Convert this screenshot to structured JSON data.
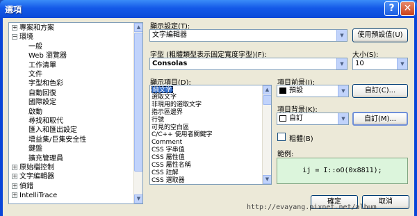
{
  "window": {
    "title": "選項",
    "help_glyph": "?",
    "close_glyph": "✕"
  },
  "tree": {
    "items": [
      {
        "label": "專案和方案",
        "twisty": "+"
      },
      {
        "label": "環境",
        "twisty": "−"
      },
      {
        "label": "一般"
      },
      {
        "label": "Web 瀏覽器"
      },
      {
        "label": "工作清單"
      },
      {
        "label": "文件"
      },
      {
        "label": "字型和色彩"
      },
      {
        "label": "自動回復"
      },
      {
        "label": "國際設定"
      },
      {
        "label": "啟動"
      },
      {
        "label": "尋找和取代"
      },
      {
        "label": "匯入和匯出設定"
      },
      {
        "label": "增益集/巨集安全性"
      },
      {
        "label": "鍵盤"
      },
      {
        "label": "擴充管理員"
      },
      {
        "label": "原始檔控制",
        "twisty": "+"
      },
      {
        "label": "文字編輯器",
        "twisty": "+"
      },
      {
        "label": "偵錯",
        "twisty": "+"
      },
      {
        "label": "IntelliTrace",
        "twisty": "+"
      }
    ]
  },
  "settings": {
    "show_settings_label": "顯示設定(T):",
    "show_settings_value": "文字編輯器",
    "use_defaults_button": "使用預設值(U)",
    "font_label": "字型 (粗體類型表示固定寬度字型)(F):",
    "font_value": "Consolas",
    "size_label": "大小(S):",
    "size_value": "10"
  },
  "display_items": {
    "label": "顯示項目(D):",
    "items": [
      "純文字",
      "選取文字",
      "非現用的選取文字",
      "指示區邊界",
      "行號",
      "可見的空白區",
      "C/C++ 使用者關鍵字",
      "Comment",
      "CSS 字串值",
      "CSS 屬性值",
      "CSS 屬性名稱",
      "CSS 註解",
      "CSS 選取器"
    ],
    "selected": "純文字"
  },
  "foreground": {
    "label": "項目前景(I):",
    "value": "預設",
    "swatch_color": "#000000",
    "custom_button": "自訂(C)..."
  },
  "background": {
    "label": "項目背景(K):",
    "value": "自訂",
    "swatch_color": "#ffffff",
    "custom_button": "自訂(M)..."
  },
  "bold": {
    "label": "粗體(B)",
    "checked": false
  },
  "sample": {
    "label": "範例:",
    "text": "ij = I::oO(0x8811);"
  },
  "footer": {
    "ok_button": "確定",
    "cancel_button": "取消",
    "watermark": "http://evayang.pixnet.net/album"
  },
  "colors": {
    "title_bar": "#1459e8",
    "dialog_face": "#ece9d8",
    "selection": "#316ac5",
    "sample_background": "#dcf5dc"
  }
}
